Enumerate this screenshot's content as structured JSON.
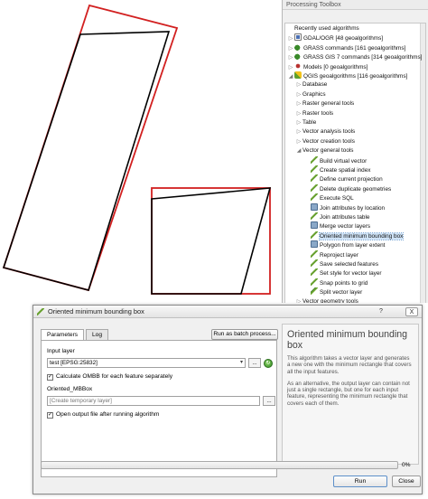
{
  "toolbox": {
    "title": "Processing Toolbox",
    "tree": [
      {
        "indent": 0,
        "arrow": "",
        "icon": "none",
        "label": "Recently used algorithms"
      },
      {
        "indent": 0,
        "arrow": "▷",
        "icon": "gdal",
        "label": "GDAL/OGR [48 geoalgorithms]"
      },
      {
        "indent": 0,
        "arrow": "▷",
        "icon": "grass",
        "label": "GRASS commands [161 geoalgorithms]"
      },
      {
        "indent": 0,
        "arrow": "▷",
        "icon": "grass",
        "label": "GRASS GIS 7 commands [314 geoalgorithms]"
      },
      {
        "indent": 0,
        "arrow": "▷",
        "icon": "models",
        "label": "Models [0 geoalgorithms]"
      },
      {
        "indent": 0,
        "arrow": "◢",
        "icon": "qgis",
        "label": "QGIS geoalgorithms [116 geoalgorithms]"
      },
      {
        "indent": 1,
        "arrow": "▷",
        "icon": "none",
        "label": "Database"
      },
      {
        "indent": 1,
        "arrow": "▷",
        "icon": "none",
        "label": "Graphics"
      },
      {
        "indent": 1,
        "arrow": "▷",
        "icon": "none",
        "label": "Raster general tools"
      },
      {
        "indent": 1,
        "arrow": "▷",
        "icon": "none",
        "label": "Raster tools"
      },
      {
        "indent": 1,
        "arrow": "▷",
        "icon": "none",
        "label": "Table"
      },
      {
        "indent": 1,
        "arrow": "▷",
        "icon": "none",
        "label": "Vector analysis tools"
      },
      {
        "indent": 1,
        "arrow": "▷",
        "icon": "none",
        "label": "Vector creation tools"
      },
      {
        "indent": 1,
        "arrow": "◢",
        "icon": "none",
        "label": "Vector general tools"
      },
      {
        "indent": 2,
        "arrow": "",
        "icon": "brush",
        "label": "Build virtual vector"
      },
      {
        "indent": 2,
        "arrow": "",
        "icon": "brush",
        "label": "Create spatial index"
      },
      {
        "indent": 2,
        "arrow": "",
        "icon": "brush",
        "label": "Define current projection"
      },
      {
        "indent": 2,
        "arrow": "",
        "icon": "brush",
        "label": "Delete duplicate geometries"
      },
      {
        "indent": 2,
        "arrow": "",
        "icon": "brush",
        "label": "Execute SQL"
      },
      {
        "indent": 2,
        "arrow": "",
        "icon": "tool",
        "label": "Join attributes by location"
      },
      {
        "indent": 2,
        "arrow": "",
        "icon": "brush",
        "label": "Join attributes table"
      },
      {
        "indent": 2,
        "arrow": "",
        "icon": "tool",
        "label": "Merge vector layers"
      },
      {
        "indent": 2,
        "arrow": "",
        "icon": "brush",
        "label": "Oriented minimum bounding box",
        "selected": true
      },
      {
        "indent": 2,
        "arrow": "",
        "icon": "tool",
        "label": "Polygon from layer extent"
      },
      {
        "indent": 2,
        "arrow": "",
        "icon": "brush",
        "label": "Reproject layer"
      },
      {
        "indent": 2,
        "arrow": "",
        "icon": "brush",
        "label": "Save selected features"
      },
      {
        "indent": 2,
        "arrow": "",
        "icon": "brush",
        "label": "Set style for vector layer"
      },
      {
        "indent": 2,
        "arrow": "",
        "icon": "brush",
        "label": "Snap points to grid"
      },
      {
        "indent": 2,
        "arrow": "",
        "icon": "brush2",
        "label": "Split vector layer"
      },
      {
        "indent": 1,
        "arrow": "▷",
        "icon": "none",
        "label": "Vector geometry tools"
      },
      {
        "indent": 1,
        "arrow": "▷",
        "icon": "none",
        "label": "Vector overlay tools"
      },
      {
        "indent": 1,
        "arrow": "▷",
        "icon": "none",
        "label": "Vector selection tools"
      }
    ]
  },
  "dialog": {
    "title": "Oriented minimum bounding box",
    "help_button": "?",
    "close_button": "X",
    "tabs": [
      "Parameters",
      "Log"
    ],
    "batch_button": "Run as batch process...",
    "input_layer_label": "Input layer",
    "input_layer_value": "test [EPSG:25832]",
    "browse_label": "...",
    "checkbox_label": "Calculate OMBB for each feature separately",
    "output_label": "Oriented_MBBox",
    "output_placeholder": "[Create temporary layer]",
    "open_output_label": "Open output file after running algorithm",
    "help_title": "Oriented minimum bounding box",
    "help_p1": "This algorithm takes a vector layer and generates a new one with the minimum rectangle that covers all the input features.",
    "help_p2": "As an alternative, the output layer can contain not just a single rectangle, but one for each input feature, representing the minimum rectangle that covers each of them.",
    "progress_percent": 0,
    "progress_text": "0%",
    "run_button": "Run",
    "close_button_label": "Close"
  },
  "colors": {
    "bbox_outline": "#d22020",
    "feature_line": "#000000",
    "selection": "#cfe3f7"
  }
}
